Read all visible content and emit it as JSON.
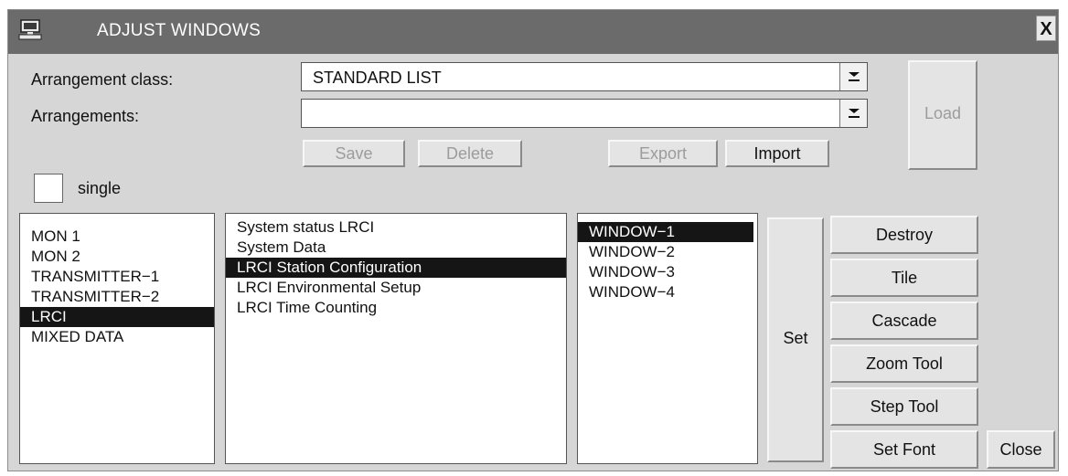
{
  "window": {
    "title": "ADJUST WINDOWS",
    "close_label": "X"
  },
  "form": {
    "arrangement_class_label": "Arrangement class:",
    "arrangement_class_value": "STANDARD LIST",
    "arrangements_label": "Arrangements:",
    "arrangements_value": ""
  },
  "buttons": {
    "load": "Load",
    "save": "Save",
    "delete": "Delete",
    "export": "Export",
    "import": "Import",
    "set": "Set",
    "destroy": "Destroy",
    "tile": "Tile",
    "cascade": "Cascade",
    "zoom_tool": "Zoom Tool",
    "step_tool": "Step Tool",
    "set_font": "Set Font",
    "close": "Close"
  },
  "single_checkbox": {
    "label": "single",
    "checked": false
  },
  "list_sources": {
    "items": [
      "MON 1",
      "MON 2",
      "TRANSMITTER−1",
      "TRANSMITTER−2",
      "LRCI",
      "MIXED DATA"
    ],
    "selected_index": 4
  },
  "list_displays": {
    "items": [
      "System status LRCI",
      "System Data",
      "LRCI Station Configuration",
      "LRCI Environmental Setup",
      "LRCI Time Counting"
    ],
    "selected_index": 2
  },
  "list_windows": {
    "items": [
      "WINDOW−1",
      "WINDOW−2",
      "WINDOW−3",
      "WINDOW−4"
    ],
    "selected_index": 0
  }
}
